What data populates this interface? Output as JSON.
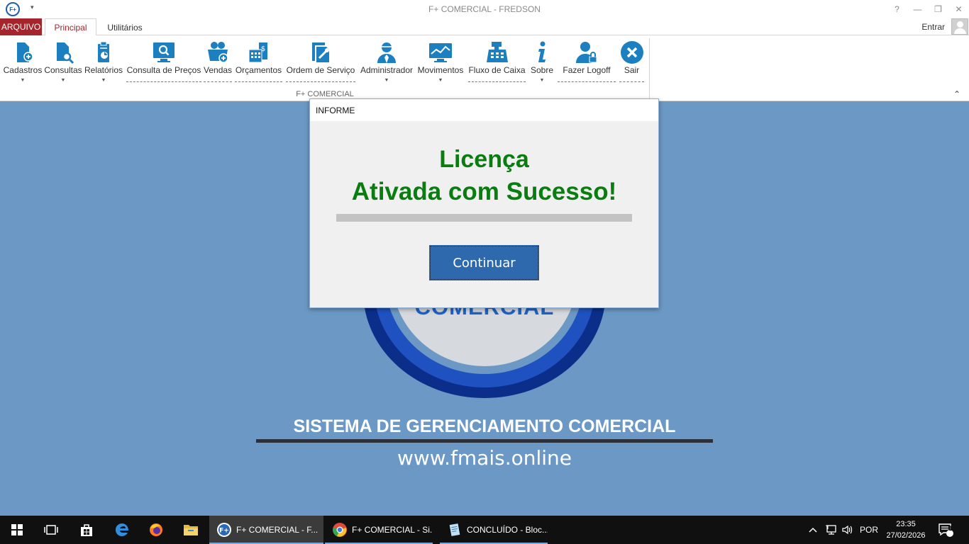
{
  "window": {
    "title": "F+ COMERCIAL - FREDSON",
    "app_badge": "F+",
    "qa_arrow": "▾",
    "controls": [
      "?",
      "—",
      "❐",
      "✕"
    ]
  },
  "tabs": {
    "arquivo": "ARQUIVO",
    "principal": "Principal",
    "utilitarios": "Utilitários",
    "entrar": "Entrar"
  },
  "ribbon": {
    "group_label": "F+ COMERCIAL",
    "collapse": "⌃",
    "dropdown_glyph": "▼",
    "buttons": [
      {
        "label": "Cadastros",
        "icon": "doc-add-icon"
      },
      {
        "label": "Consultas",
        "icon": "doc-search-icon"
      },
      {
        "label": "Relatórios",
        "icon": "report-icon"
      },
      {
        "label": "Consulta de Preços",
        "icon": "price-monitor-icon"
      },
      {
        "label": "Vendas",
        "icon": "basket-icon"
      },
      {
        "label": "Orçamentos",
        "icon": "calculator-icon"
      },
      {
        "label": "Ordem de Serviço",
        "icon": "service-order-icon"
      },
      {
        "label": "Administrador",
        "icon": "admin-user-icon"
      },
      {
        "label": "Movimentos",
        "icon": "chart-monitor-icon"
      },
      {
        "label": "Fluxo de Caixa",
        "icon": "cash-register-icon"
      },
      {
        "label": "Sobre",
        "icon": "info-icon"
      },
      {
        "label": "Fazer Logoff",
        "icon": "logoff-user-icon"
      },
      {
        "label": "Sair",
        "icon": "close-circle-icon"
      }
    ]
  },
  "background": {
    "logo_word": "COMERCIAL",
    "system_title": "SISTEMA DE GERENCIAMENTO COMERCIAL",
    "url": "www.fmais.online"
  },
  "dialog": {
    "title": "INFORME",
    "line1": "Licença",
    "line2": "Ativada com Sucesso!",
    "progress_fraction": 1.0,
    "button": "Continuar"
  },
  "taskbar": {
    "apps": [
      {
        "label": "F+ COMERCIAL - F...",
        "icon": "fplus-app-icon"
      },
      {
        "label": "F+ COMERCIAL - Si...",
        "icon": "chrome-icon"
      },
      {
        "label": "CONCLUÍDO - Bloc...",
        "icon": "notepad-icon"
      }
    ],
    "language": "POR",
    "time": "23:35",
    "date": "27/02/2026",
    "notifications": "1"
  },
  "colors": {
    "accent_red": "#a4262c",
    "ribbon_icon_blue": "#1c7fc0",
    "desktop_blue": "#6b98c4",
    "success_green": "#0a7d10",
    "button_blue": "#2e69ad"
  }
}
